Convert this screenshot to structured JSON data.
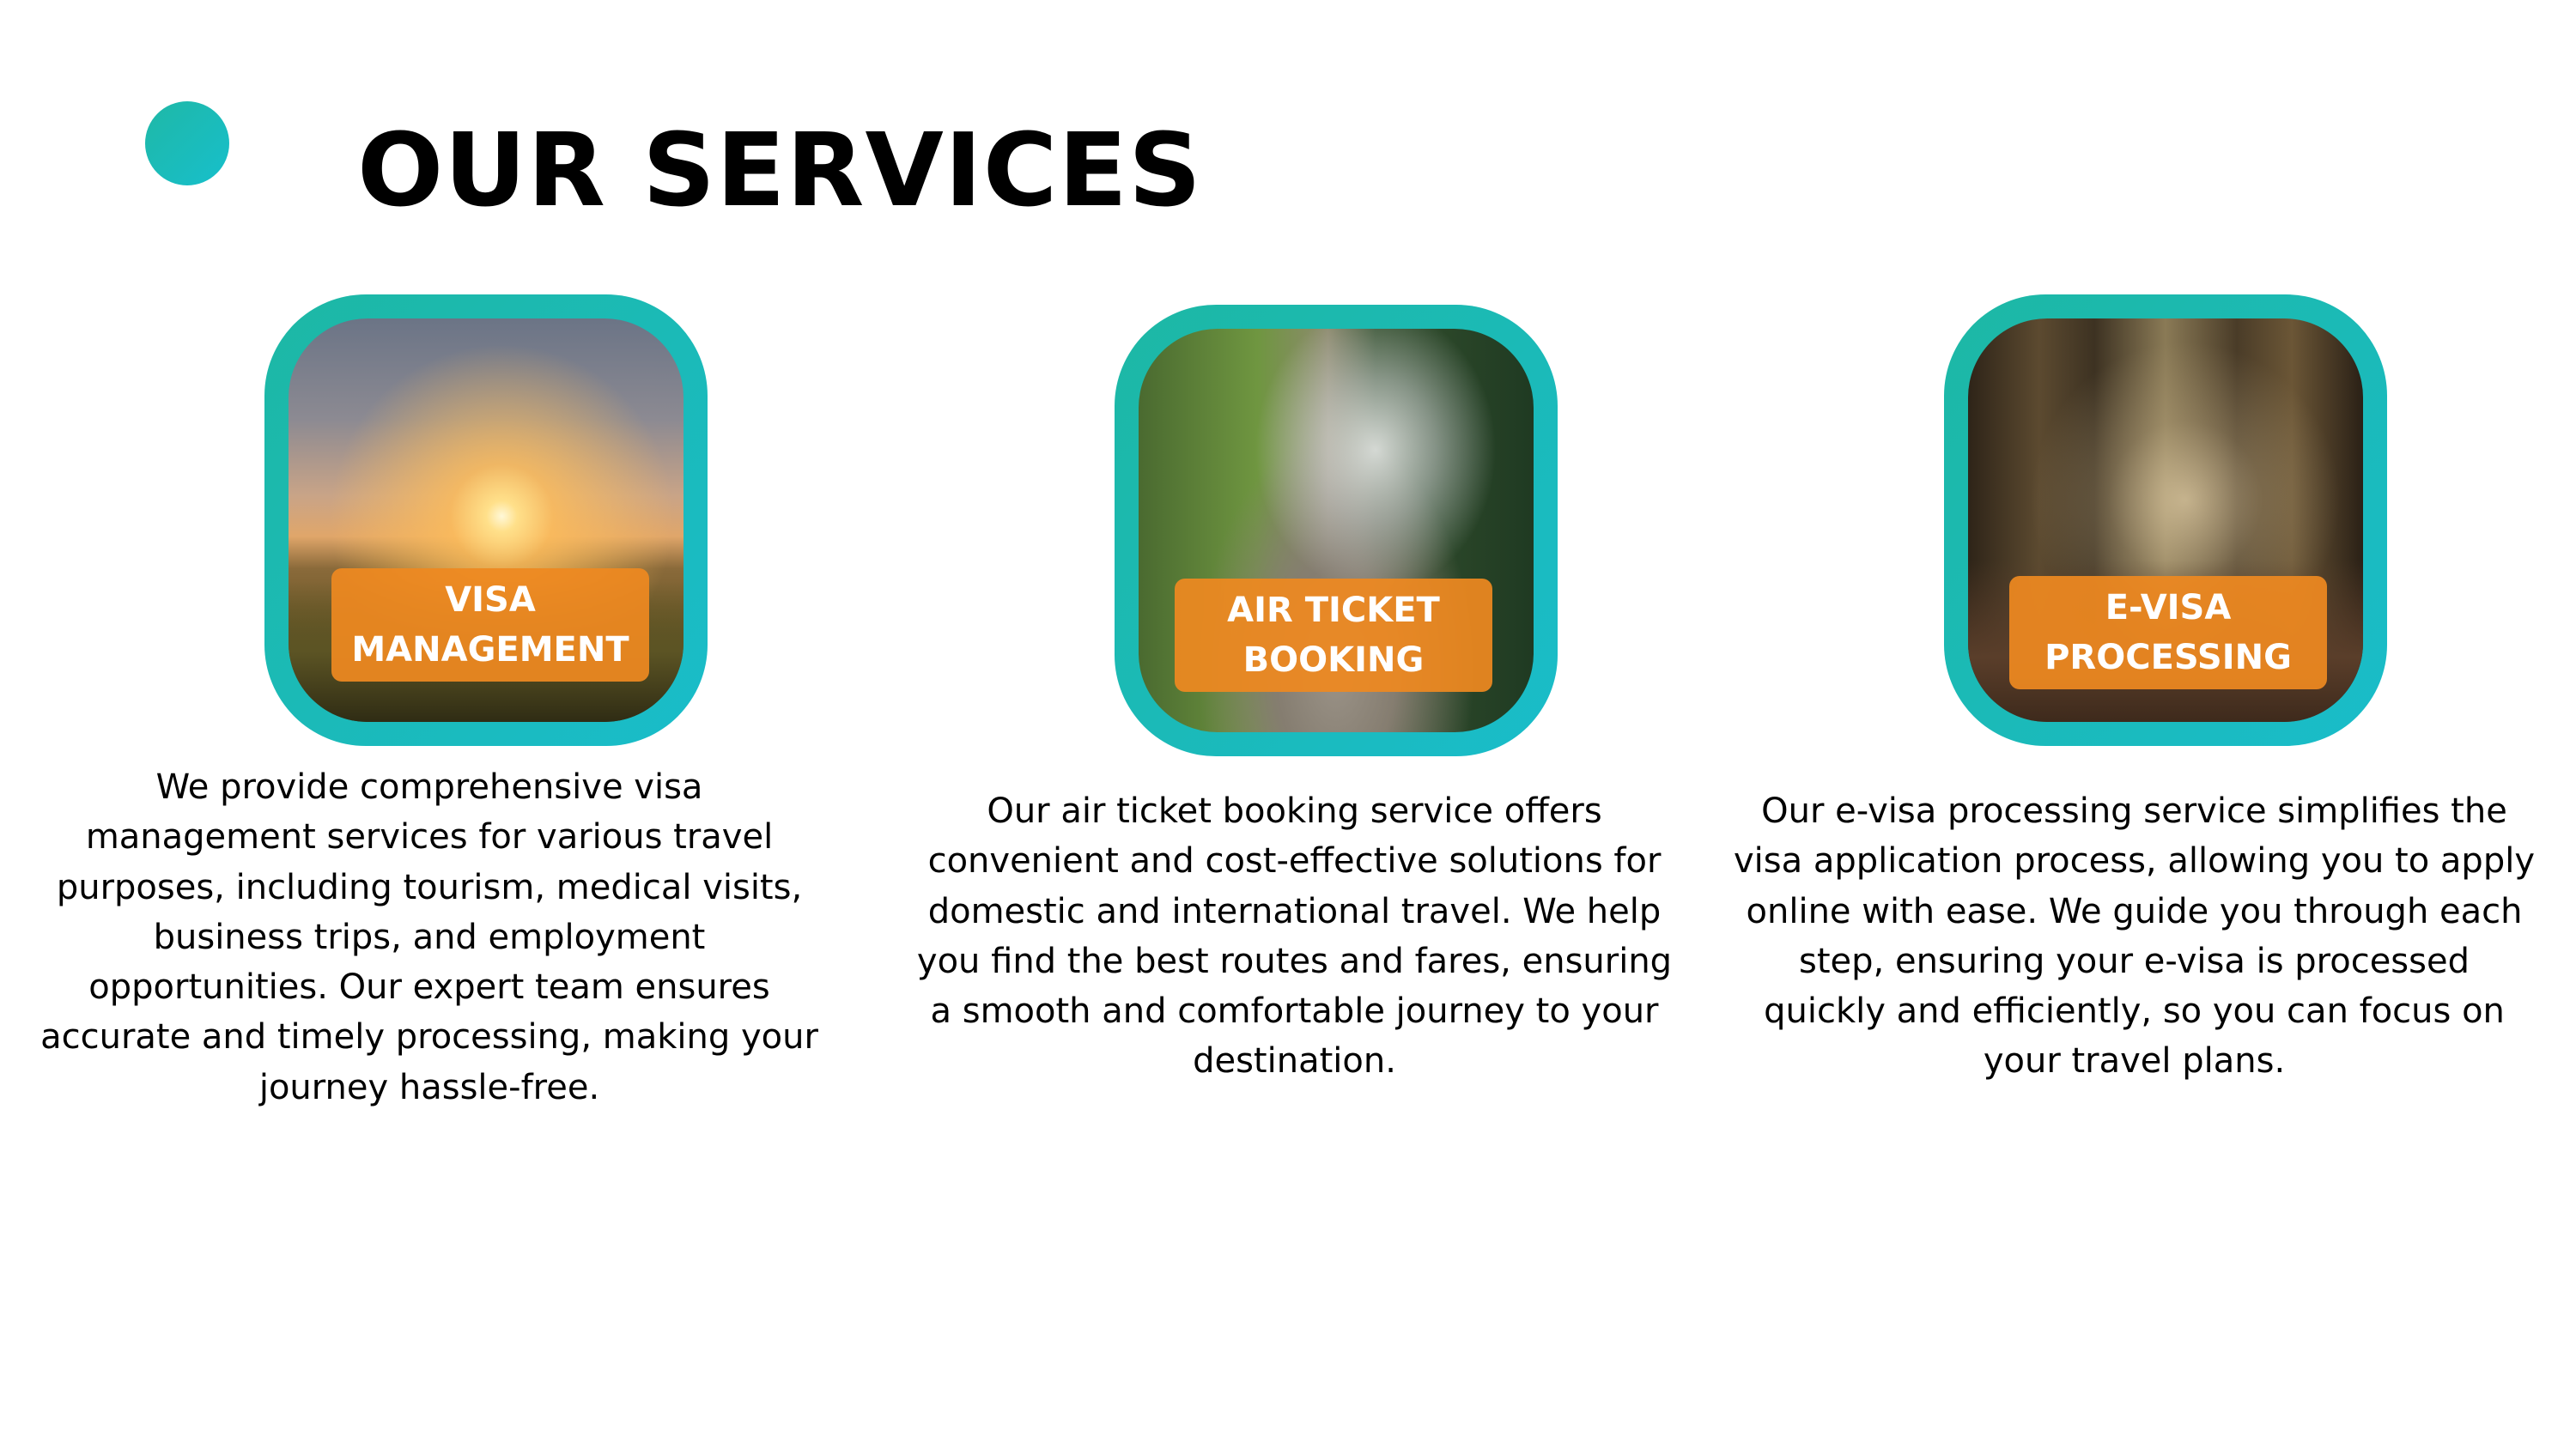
{
  "title": "OUR SERVICES",
  "colors": {
    "accent": "#1cbab0",
    "label_background": "#ee8920",
    "text": "#000000"
  },
  "services": [
    {
      "label": "VISA\nMANAGEMENT",
      "description": "We provide comprehensive visa management services for various travel purposes, including tourism, medical visits, business trips, and employment opportunities. Our expert team ensures accurate and timely processing, making your journey hassle-free."
    },
    {
      "label": "AIR TICKET\nBOOKING",
      "description": "Our air ticket booking service offers convenient and cost-effective solutions for domestic and international travel. We help you find the best routes and fares, ensuring a smooth and comfortable journey to your destination."
    },
    {
      "label": "E-VISA\nPROCESSING",
      "description": "Our e-visa processing service simplifies the visa application process, allowing you to apply online with ease. We guide you through each step, ensuring your e-visa is processed quickly and efficiently, so you can focus on your travel plans."
    }
  ]
}
